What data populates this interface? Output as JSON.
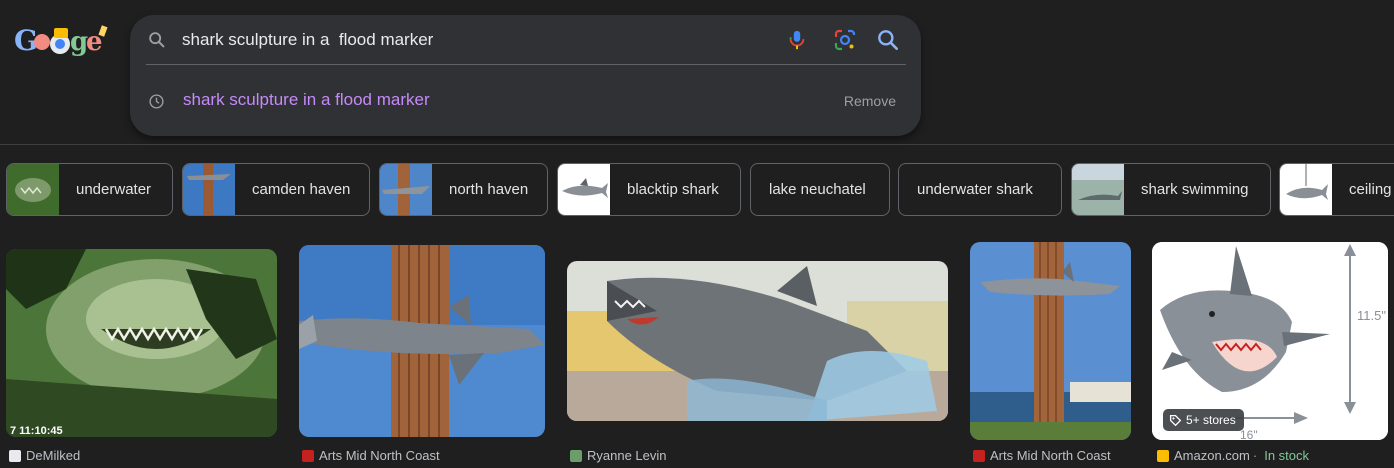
{
  "header": {
    "logo_text": "Google",
    "search": {
      "query": "shark sculpture in a  flood marker",
      "icons": [
        "search-icon",
        "mic-icon",
        "lens-icon",
        "search-button-icon"
      ]
    },
    "suggestion": {
      "text": "shark sculpture in a flood marker",
      "remove_label": "Remove",
      "icon": "history-clock-icon"
    }
  },
  "chips": [
    {
      "label": "underwater"
    },
    {
      "label": "camden haven"
    },
    {
      "label": "north haven"
    },
    {
      "label": "blacktip shark"
    },
    {
      "label": "lake neuchatel"
    },
    {
      "label": "underwater shark"
    },
    {
      "label": "shark swimming"
    },
    {
      "label": "ceiling"
    }
  ],
  "results": [
    {
      "source": "DeMilked",
      "overlay": "7 11:10:45"
    },
    {
      "source": "Arts Mid North Coast"
    },
    {
      "source": "Ryanne Levin"
    },
    {
      "source": "Arts Mid North Coast"
    },
    {
      "source": "Amazon.com",
      "availability": "In stock",
      "badge": "5+ stores",
      "dim_height": "11.5\"",
      "dim_width": "16\""
    }
  ],
  "colors": {
    "background": "#1f1f1f",
    "search_box": "#303134",
    "visited_link": "#c58af9",
    "in_stock": "#81c995"
  }
}
